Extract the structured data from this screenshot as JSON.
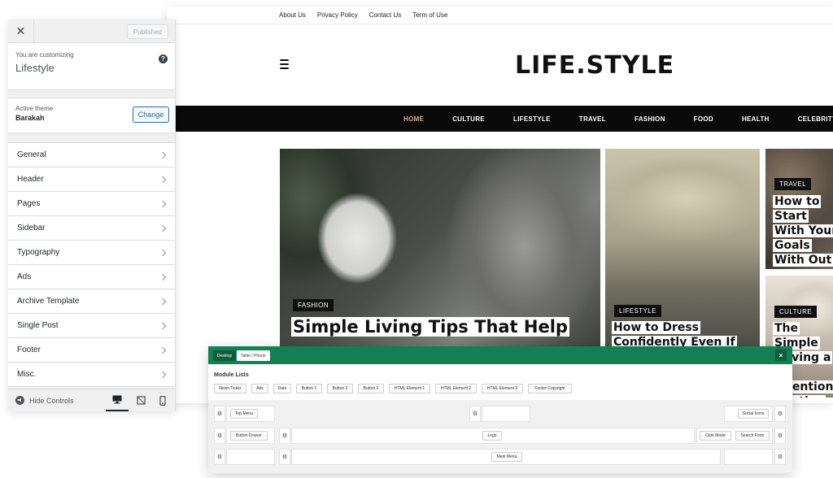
{
  "site": {
    "top_menu": [
      "About Us",
      "Privacy Policy",
      "Contact Us",
      "Term of Use"
    ],
    "logo": "LIFE.STYLE",
    "nav": [
      "HOME",
      "CULTURE",
      "LIFESTYLE",
      "TRAVEL",
      "FASHION",
      "FOOD",
      "HEALTH",
      "CELEBRITY"
    ],
    "active_nav": "HOME",
    "accent_color": "#d9a98a",
    "cards": [
      {
        "category": "FASHION",
        "title": "Simple Living Tips That Help"
      },
      {
        "category": "LIFESTYLE",
        "title": "How to Dress Confidently Even If"
      },
      {
        "category": "TRAVEL",
        "title": "How to Start With Your Goals With Out"
      },
      {
        "category": "CULTURE",
        "title": "The Simple Having a S Intentiona Routine"
      }
    ]
  },
  "customizer": {
    "close_icon": "close-icon",
    "published_label": "Published",
    "customizing_label": "You are customizing",
    "site_name": "Lifestyle",
    "help_icon": "help-icon",
    "active_theme_label": "Active theme",
    "theme_name": "Barakah",
    "change_label": "Change",
    "sections": [
      "General",
      "Header",
      "Pages",
      "Sidebar",
      "Typography",
      "Ads",
      "Archive Template",
      "Single Post",
      "Footer",
      "Misc."
    ],
    "hide_controls_label": "Hide Controls",
    "devices": [
      "desktop-icon",
      "tablet-icon",
      "mobile-icon"
    ],
    "active_device": "desktop"
  },
  "builder": {
    "tabs": [
      "Desktop",
      "Table / Phone"
    ],
    "active_tab": "Desktop",
    "close_label": "×",
    "module_title": "Module Lists",
    "modules": [
      "News Ticker",
      "Ads",
      "Date",
      "Button 1",
      "Button 2",
      "Button 3",
      "HTML Element 1",
      "HTML Element 2",
      "HTML Element 3",
      "Footer Copyright"
    ],
    "row1": {
      "left": "Top Menu",
      "right": "Social Icons"
    },
    "row2": {
      "left": "Button Drawer",
      "center": "Logo",
      "right": [
        "Dark Mode",
        "Search Form"
      ]
    },
    "row3": {
      "center": "Main Menu"
    },
    "brand_color": "#128054"
  }
}
